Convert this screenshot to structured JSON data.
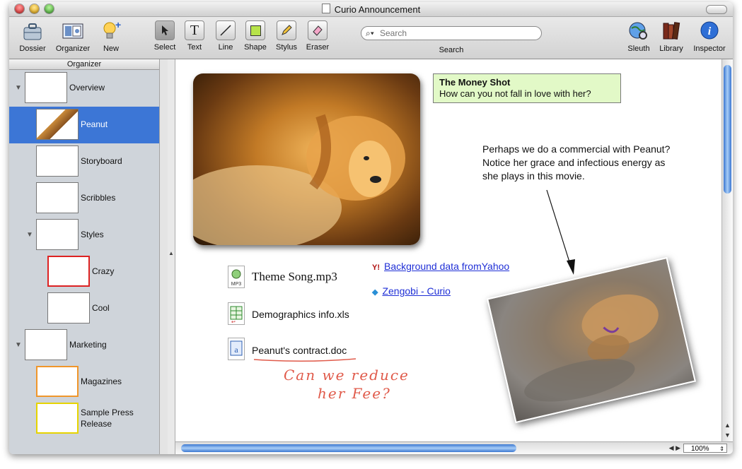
{
  "window": {
    "title": "Curio Announcement"
  },
  "toolbar": {
    "dossier": "Dossier",
    "organizer": "Organizer",
    "new": "New",
    "select": "Select",
    "text": "Text",
    "line": "Line",
    "shape": "Shape",
    "stylus": "Stylus",
    "eraser": "Eraser",
    "search_placeholder": "Search",
    "search_label": "Search",
    "sleuth": "Sleuth",
    "library": "Library",
    "inspector": "Inspector"
  },
  "sidebar": {
    "header": "Organizer",
    "items": [
      {
        "label": "Overview"
      },
      {
        "label": "Peanut"
      },
      {
        "label": "Storyboard"
      },
      {
        "label": "Scribbles"
      },
      {
        "label": "Styles"
      },
      {
        "label": "Crazy"
      },
      {
        "label": "Cool"
      },
      {
        "label": "Marketing"
      },
      {
        "label": "Magazines"
      },
      {
        "label": "Sample Press",
        "label2": "Release"
      }
    ]
  },
  "canvas": {
    "note_title": "The Money Shot",
    "note_body": "How can you not fall in love with her?",
    "caption_lines": [
      "Perhaps we do a commercial with Peanut?",
      "Notice her grace and infectious energy as",
      "she plays in this movie."
    ],
    "files": [
      {
        "name": "Theme Song.mp3",
        "icon_text": "MP3"
      },
      {
        "name": "Demographics info.xls"
      },
      {
        "name": "Peanut's contract.doc"
      }
    ],
    "links": [
      {
        "text": "Background data fromYahoo",
        "icon": "Y!"
      },
      {
        "text": "Zengobi - Curio"
      }
    ],
    "handwriting": [
      "Can we reduce",
      "her Fee?"
    ]
  },
  "status": {
    "zoom": "100%"
  },
  "colors": {
    "selection": "#3c76d6",
    "note_bg": "#e2f9c7",
    "link": "#1f2fd6",
    "ink": "#e05a4a"
  }
}
